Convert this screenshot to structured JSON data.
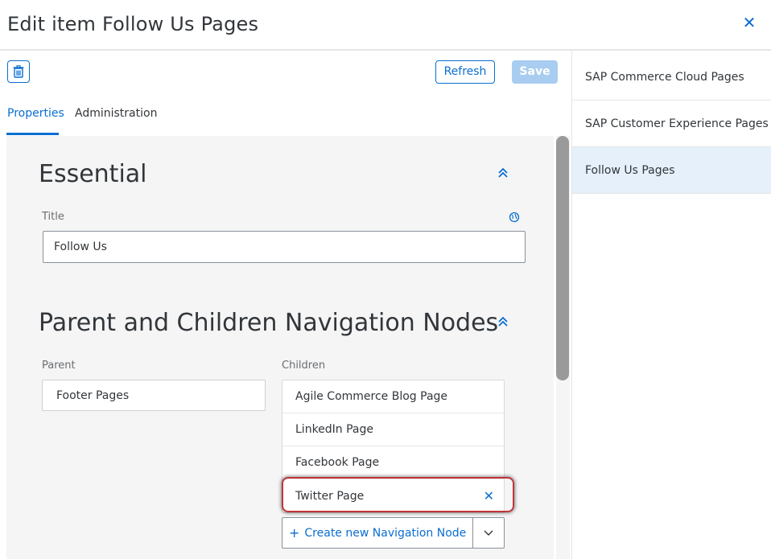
{
  "header": {
    "title": "Edit item Follow Us Pages"
  },
  "toolbar": {
    "refresh_label": "Refresh",
    "save_label": "Save"
  },
  "tabs": [
    {
      "label": "Properties"
    },
    {
      "label": "Administration"
    }
  ],
  "sections": {
    "essential": {
      "title": "Essential",
      "title_field": {
        "label": "Title",
        "value": "Follow Us"
      }
    },
    "navigation": {
      "title": "Parent and Children Navigation Nodes",
      "parent": {
        "label": "Parent",
        "value": "Footer Pages"
      },
      "children": {
        "label": "Children",
        "items": [
          {
            "label": "Agile Commerce Blog Page"
          },
          {
            "label": "LinkedIn Page"
          },
          {
            "label": "Facebook Page"
          },
          {
            "label": "Twitter Page"
          }
        ],
        "create_label": "Create new Navigation Node"
      }
    }
  },
  "right_pane": {
    "items": [
      {
        "label": "SAP Commerce Cloud Pages",
        "selected": false
      },
      {
        "label": "SAP Customer Experience Pages",
        "selected": false
      },
      {
        "label": "Follow Us Pages",
        "selected": true
      }
    ]
  },
  "colors": {
    "accent": "#0a6ed1",
    "highlight": "#c0353a",
    "selected_bg": "#e5f0fa"
  }
}
